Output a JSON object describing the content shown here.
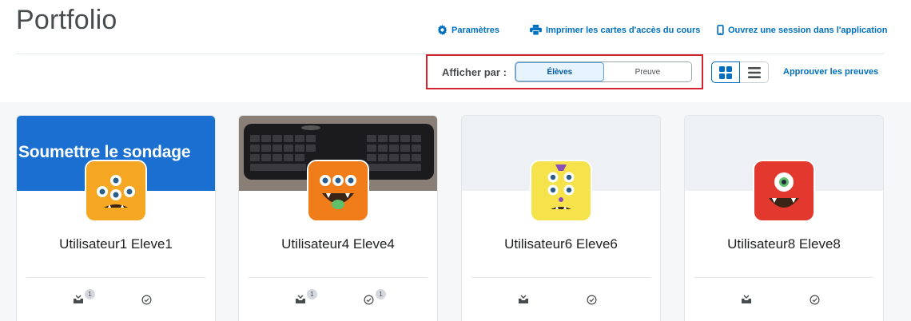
{
  "page": {
    "title": "Portfolio"
  },
  "toplinks": {
    "settings": "Paramètres",
    "print": "Imprimer les cartes d'accès du cours",
    "app": "Ouvrez une session dans l'application"
  },
  "viewby": {
    "label": "Afficher par :",
    "options": [
      "Élèves",
      "Preuve"
    ],
    "selected": "Élèves"
  },
  "view_toggle": {
    "grid_icon": "grid-icon",
    "list_icon": "list-icon",
    "selected": "grid"
  },
  "approve_link": "Approuver les preuves",
  "colors": {
    "link": "#006fbf",
    "highlight_border": "#d3232f",
    "banner_blue": "#1a6fd0"
  },
  "cards": [
    {
      "name": "Utilisateur1 Eleve1",
      "banner_text": "Soumettre le sondage",
      "evidence_count": "1",
      "approval_count": ""
    },
    {
      "name": "Utilisateur4 Eleve4",
      "banner_text": "",
      "evidence_count": "1",
      "approval_count": "1"
    },
    {
      "name": "Utilisateur6 Eleve6",
      "banner_text": "",
      "evidence_count": "",
      "approval_count": ""
    },
    {
      "name": "Utilisateur8 Eleve8",
      "banner_text": "",
      "evidence_count": "",
      "approval_count": ""
    }
  ]
}
